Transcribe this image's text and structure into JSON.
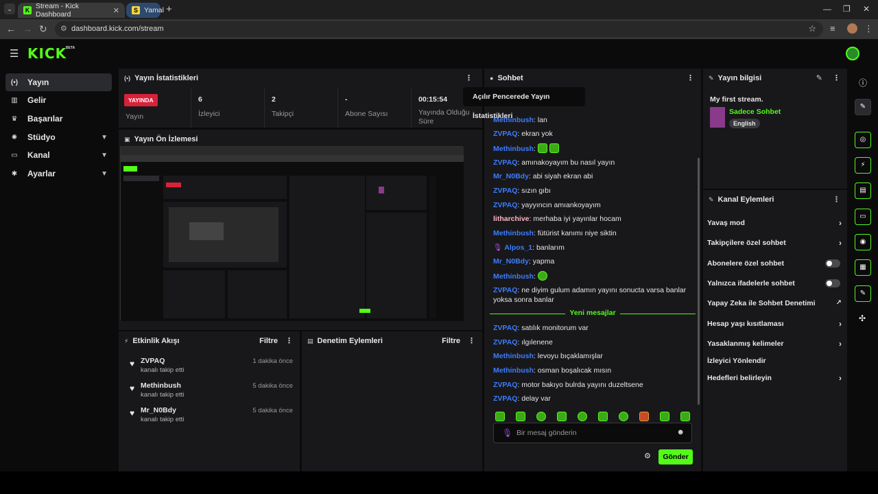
{
  "browser": {
    "tabs": [
      {
        "title": "Stream - Kick Dashboard",
        "favicon": "K",
        "favicon_color": "#53fc18"
      },
      {
        "title": "Yamal",
        "favicon": "S",
        "favicon_color": "#f5d43b"
      }
    ],
    "url": "dashboard.kick.com/stream"
  },
  "nav": {
    "items": [
      {
        "label": "Yayın",
        "icon": "broadcast-icon",
        "glyph": "(•)"
      },
      {
        "label": "Gelir",
        "icon": "revenue-icon",
        "glyph": "▥"
      },
      {
        "label": "Başarılar",
        "icon": "trophy-icon",
        "glyph": "♛"
      },
      {
        "label": "Stüdyo",
        "icon": "studio-icon",
        "glyph": "✺"
      },
      {
        "label": "Kanal",
        "icon": "channel-icon",
        "glyph": "▭"
      },
      {
        "label": "Ayarlar",
        "icon": "settings-icon",
        "glyph": "✱"
      }
    ]
  },
  "stats_panel": {
    "title": "Yayın İstatistikleri",
    "tooltip": "Açılır Pencerede Yayın İstatistikleri",
    "live_badge": "YAYINDA",
    "live_label": "Yayın",
    "viewers_value": "6",
    "viewers_label": "İzleyici",
    "followers_value": "2",
    "followers_label": "Takipçi",
    "subs_value": "-",
    "subs_label": "Abone Sayısı",
    "uptime_value": "00:15:54",
    "uptime_label": "Yayında Olduğu Süre"
  },
  "preview_panel": {
    "title": "Yayın Ön İzlemesi"
  },
  "activity_panel": {
    "title": "Etkinlik Akışı",
    "filter": "Filtre",
    "events": [
      {
        "name": "ZVPAQ",
        "action": "kanalı takip etti",
        "time": "1 dakika önce"
      },
      {
        "name": "Methinbush",
        "action": "kanalı takip etti",
        "time": "5 dakika önce"
      },
      {
        "name": "Mr_N0Bdy",
        "action": "kanalı takip etti",
        "time": "5 dakika önce"
      }
    ]
  },
  "moderation_panel": {
    "title": "Denetim Eylemleri",
    "filter": "Filtre"
  },
  "chat": {
    "title": "Sohbet",
    "messages": [
      {
        "user": "Methinbush",
        "text": "lan",
        "color": "#3d7dff"
      },
      {
        "user": "ZVPAQ",
        "text": "ekran yok",
        "color": "#3d7dff"
      },
      {
        "user": "Methinbush",
        "text": "",
        "color": "#3d7dff"
      },
      {
        "user": "ZVPAQ",
        "text": "amınakoyayım bu nasıl yayın",
        "color": "#3d7dff"
      },
      {
        "user": "Mr_N0Bdy",
        "text": "abi siyah ekran abi",
        "color": "#3d7dff"
      },
      {
        "user": "ZVPAQ",
        "text": "sızın gıbı",
        "color": "#3d7dff"
      },
      {
        "user": "ZVPAQ",
        "text": "yayyıncın amıankoyayım",
        "color": "#3d7dff"
      },
      {
        "user": "litharchive",
        "text": "merhaba iyi yayınlar hocam",
        "color": "#ffb5c5"
      },
      {
        "user": "Methinbush",
        "text": "fütürist kanımı niye siktin",
        "color": "#3d7dff"
      },
      {
        "user": "Alpos_1",
        "text": "banlarım",
        "color": "#3d7dff"
      },
      {
        "user": "Mr_N0Bdy",
        "text": "yapma",
        "color": "#3d7dff"
      },
      {
        "user": "Methinbush",
        "text": "",
        "color": "#3d7dff"
      },
      {
        "user": "ZVPAQ",
        "text": "ne diyim gulum adamın yayını sonucta varsa banlar yoksa sonra banlar",
        "color": "#3d7dff"
      }
    ],
    "new_messages_label": "Yeni mesajlar",
    "new_messages": [
      {
        "user": "ZVPAQ",
        "text": "satılık monitorum var"
      },
      {
        "user": "ZVPAQ",
        "text": "ılgılenene"
      },
      {
        "user": "Methinbush",
        "text": "levoyu bıçaklamışlar"
      },
      {
        "user": "Methinbush",
        "text": "osman boşalıcak mısın"
      },
      {
        "user": "ZVPAQ",
        "text": "motor bakıyo bulrda yayını duzeltsene"
      },
      {
        "user": "ZVPAQ",
        "text": "delay var"
      }
    ],
    "input_placeholder": "Bir mesaj gönderin",
    "send_label": "Gönder"
  },
  "stream_info": {
    "title": "Yayın bilgisi",
    "stream_title": "My first stream.",
    "category": "Sadece Sohbet",
    "language": "English"
  },
  "channel_actions": {
    "title": "Kanal Eylemleri",
    "items": [
      {
        "label": "Yavaş mod",
        "control": "chevron"
      },
      {
        "label": "Takipçilere özel sohbet",
        "control": "chevron"
      },
      {
        "label": "Abonelere özel sohbet",
        "control": "toggle"
      },
      {
        "label": "Yalnızca ifadelerle sohbet",
        "control": "toggle"
      },
      {
        "label": "Yapay Zeka ile Sohbet Denetimi",
        "control": "external"
      },
      {
        "label": "Hesap yaşı kısıtlaması",
        "control": "chevron"
      },
      {
        "label": "Yasaklanmış kelimeler",
        "control": "chevron"
      },
      {
        "label": "İzleyici Yönlendir",
        "control": "none"
      },
      {
        "label": "Hedefleri belirleyin",
        "control": "chevron"
      }
    ]
  },
  "colors": {
    "accent": "#53fc18",
    "live": "#d8223a",
    "username": "#3d7dff"
  }
}
